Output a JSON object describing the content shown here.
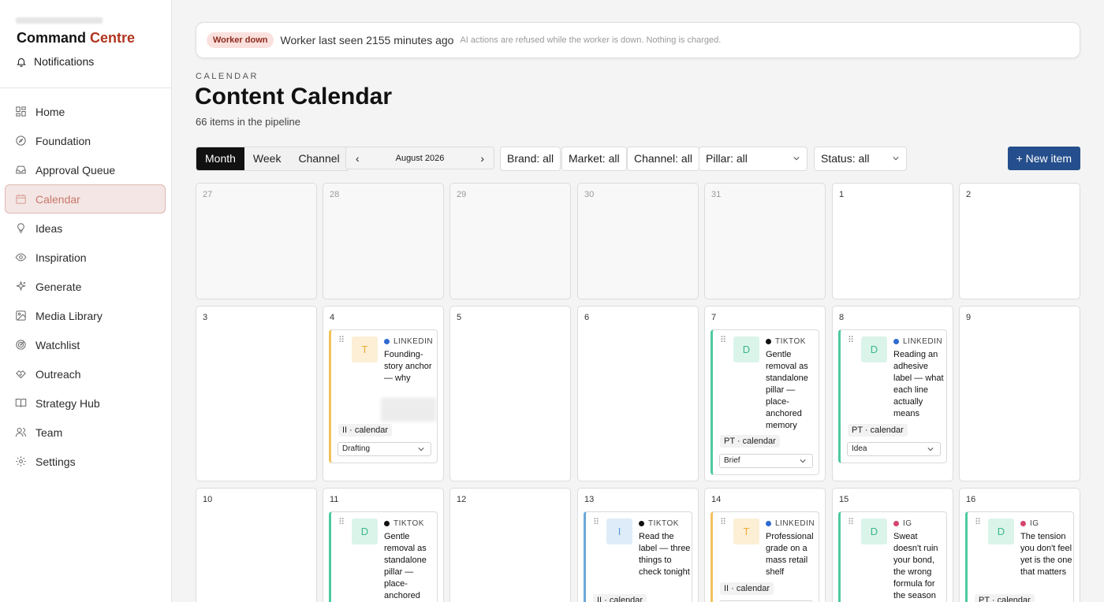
{
  "sidebar": {
    "brand_main": "Command ",
    "brand_accent": "Centre",
    "notifications": "Notifications",
    "items": [
      {
        "label": "Home",
        "icon": "grid-icon"
      },
      {
        "label": "Foundation",
        "icon": "compass-icon"
      },
      {
        "label": "Approval Queue",
        "icon": "inbox-icon"
      },
      {
        "label": "Calendar",
        "icon": "calendar-icon",
        "active": true
      },
      {
        "label": "Ideas",
        "icon": "lightbulb-icon"
      },
      {
        "label": "Inspiration",
        "icon": "eye-icon"
      },
      {
        "label": "Generate",
        "icon": "sparkle-icon"
      },
      {
        "label": "Media Library",
        "icon": "image-icon"
      },
      {
        "label": "Watchlist",
        "icon": "radar-icon"
      },
      {
        "label": "Outreach",
        "icon": "handshake-icon"
      },
      {
        "label": "Strategy Hub",
        "icon": "book-icon"
      },
      {
        "label": "Team",
        "icon": "users-icon"
      },
      {
        "label": "Settings",
        "icon": "gear-icon"
      }
    ]
  },
  "banner": {
    "badge": "Worker down",
    "message": "Worker last seen 2155 minutes ago",
    "note": "AI actions are refused while the worker is down. Nothing is charged."
  },
  "header": {
    "eyebrow": "CALENDAR",
    "title": "Content Calendar",
    "subtitle": "66 items in the pipeline"
  },
  "toolbar": {
    "views": [
      "Month",
      "Week",
      "Channel"
    ],
    "active_view": "Month",
    "period": "August 2026",
    "brand": "Brand: all",
    "market": "Market: all",
    "channel": "Channel: all",
    "pillar": "Pillar: all",
    "status": "Status: all",
    "new_item": "+ New item"
  },
  "days": {
    "row1": [
      "27",
      "28",
      "29",
      "30",
      "31",
      "1",
      "2"
    ],
    "row2": [
      "3",
      "4",
      "5",
      "6",
      "7",
      "8",
      "9"
    ],
    "row3": [
      "10",
      "11",
      "12",
      "13",
      "14",
      "15",
      "16"
    ]
  },
  "cards": [
    {
      "initial": "T",
      "platform": "LINKEDIN",
      "dot": "#2f6bd0",
      "text": "Founding-story anchor — why",
      "tag": "II · calendar",
      "status": "Drafting"
    },
    {
      "initial": "D",
      "platform": "TIKTOK",
      "dot": "#111111",
      "text": "Gentle removal as standalone pillar — place-anchored memory",
      "tag": "PT · calendar",
      "status": "Brief"
    },
    {
      "initial": "D",
      "platform": "LINKEDIN",
      "dot": "#2f6bd0",
      "text": "Reading an adhesive label — what each line actually means",
      "tag": "PT · calendar",
      "status": "Idea"
    },
    {
      "initial": "D",
      "platform": "TIKTOK",
      "dot": "#111111",
      "text": "Gentle removal as standalone pillar — place-anchored"
    },
    {
      "initial": "I",
      "platform": "TIKTOK",
      "dot": "#111111",
      "text": "Read the label — three things to check tonight",
      "tag": "II · calendar"
    },
    {
      "initial": "T",
      "platform": "LINKEDIN",
      "dot": "#2f6bd0",
      "text": "Professional grade on a mass retail shelf",
      "tag": "II · calendar"
    },
    {
      "initial": "D",
      "platform": "IG",
      "dot": "#d6456d",
      "text": "Sweat doesn't ruin your bond, the wrong formula for the season"
    },
    {
      "initial": "D",
      "platform": "IG",
      "dot": "#d6456d",
      "text": "The tension you don't feel yet is the one that matters",
      "tag": "PT · calendar"
    }
  ]
}
